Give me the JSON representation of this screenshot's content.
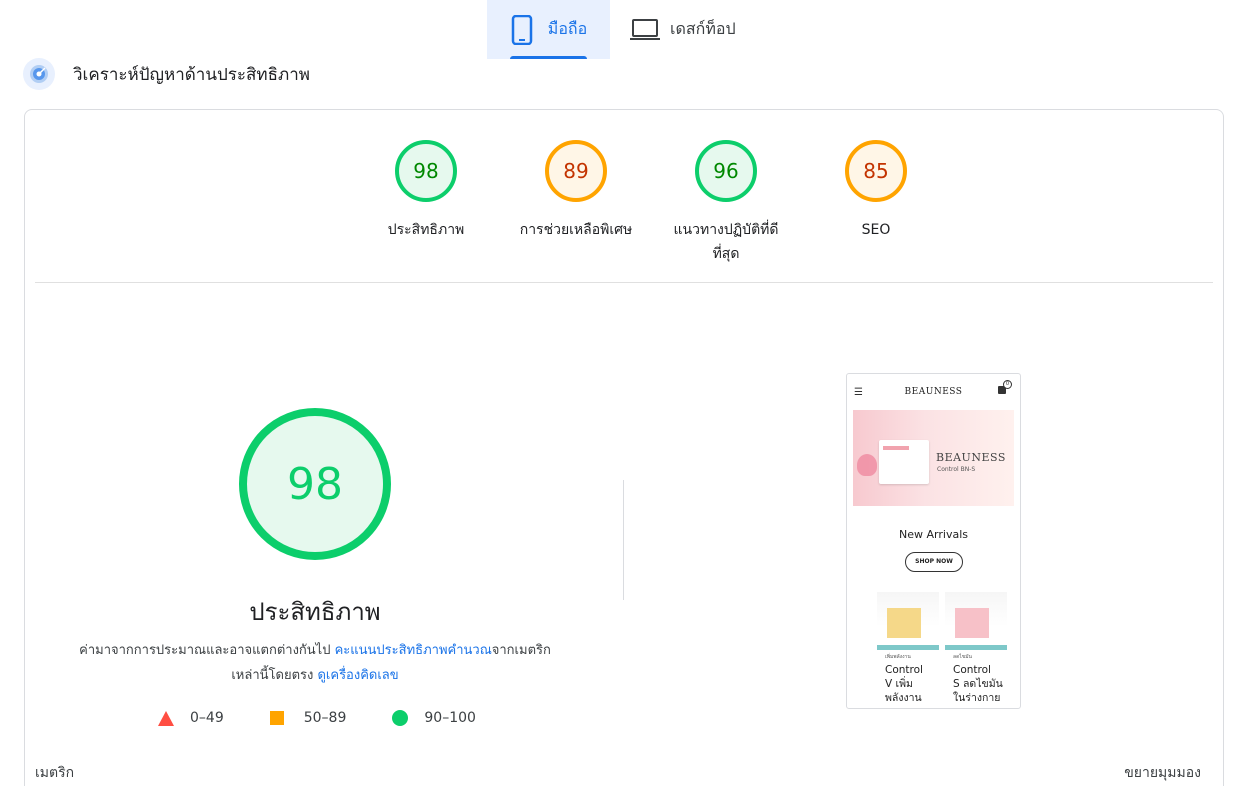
{
  "tabs": {
    "mobile": {
      "label": "มือถือ",
      "icon": "smartphone-icon",
      "active": true
    },
    "desktop": {
      "label": "เดสก์ท็อป",
      "icon": "laptop-icon",
      "active": false
    }
  },
  "section": {
    "title": "วิเคราะห์ปัญหาด้านประสิทธิภาพ",
    "icon": "radar-icon"
  },
  "scores": [
    {
      "value": "98",
      "label": "ประสิทธิภาพ",
      "status": "green"
    },
    {
      "value": "89",
      "label": "การช่วยเหลือพิเศษ",
      "status": "orange"
    },
    {
      "value": "96",
      "label": "แนวทางปฏิบัติที่ดีที่สุด",
      "status": "green"
    },
    {
      "value": "85",
      "label": "SEO",
      "status": "orange"
    }
  ],
  "performance": {
    "score": "98",
    "title": "ประสิทธิภาพ",
    "desc_part1": "ค่ามาจากการประมาณและอาจแตกต่างกันไป ",
    "desc_link1": "คะแนนประสิทธิภาพคำนวณ",
    "desc_part2": "จากเมตริกเหล่านี้โดยตรง ",
    "desc_link2": "ดูเครื่องคิดเลข"
  },
  "legend": {
    "fail": "0–49",
    "average": "50–89",
    "pass": "90–100"
  },
  "footer": {
    "metrics_label": "เมตริก",
    "expand_label": "ขยายมุมมอง"
  },
  "preview": {
    "logo": "BEAUNESS",
    "banner_brand": "BEAUNESS",
    "banner_sub": "Control BN-S",
    "heading": "New Arrivals",
    "button": "SHOP NOW",
    "products": [
      {
        "tag": "เพิ่มพลังงาน",
        "name_line1": "Control",
        "name_line2": "V เพิ่ม",
        "name_line3": "พลังงาน"
      },
      {
        "tag": "ลดไขมัน",
        "name_line1": "Control",
        "name_line2": "S ลดไขมัน",
        "name_line3": "ในร่างกาย"
      }
    ]
  },
  "colors": {
    "accent": "#1a73e8",
    "pass": "#0cce6b",
    "average": "#ffa400",
    "fail": "#ff4e42"
  }
}
